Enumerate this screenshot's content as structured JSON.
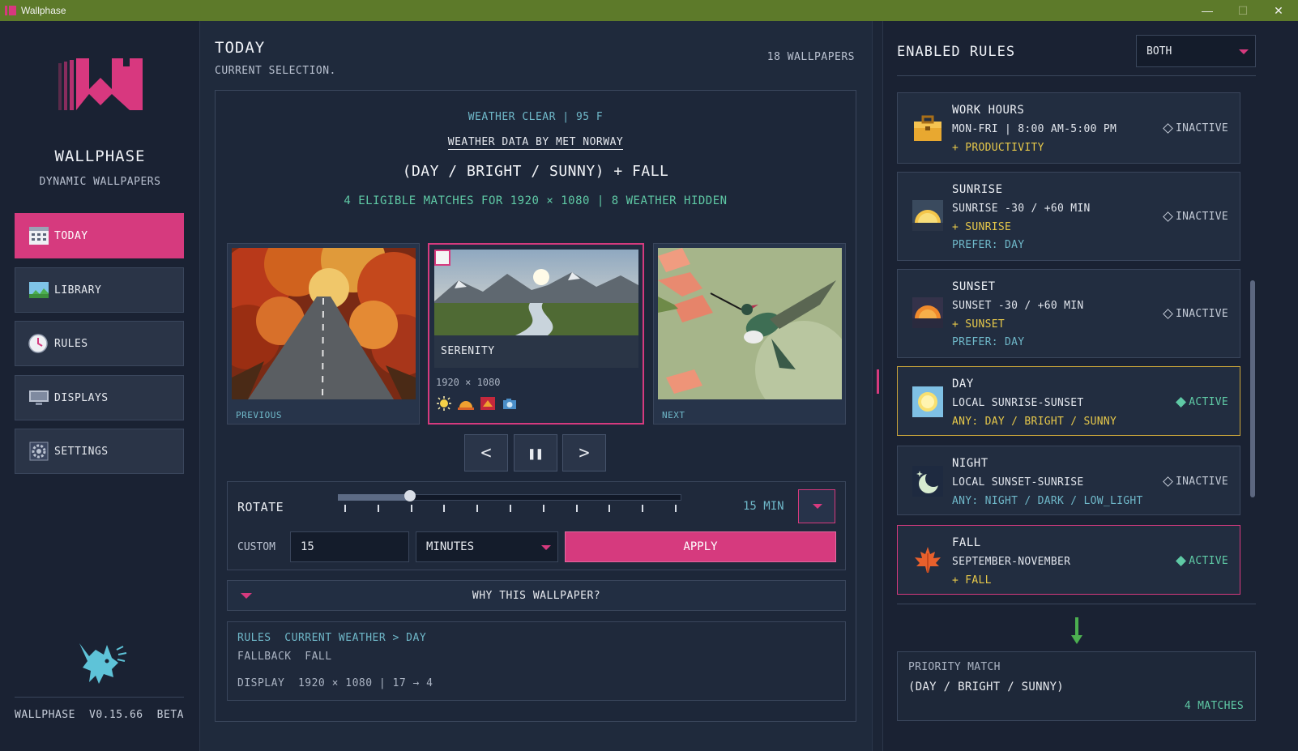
{
  "window": {
    "title": "Wallphase",
    "minimize": "—",
    "maximize": "☐",
    "close": "✕"
  },
  "sidebar": {
    "app_name": "WALLPHASE",
    "app_sub": "DYNAMIC WALLPAPERS",
    "nav": [
      {
        "label": "TODAY",
        "icon": "calendar-icon"
      },
      {
        "label": "LIBRARY",
        "icon": "landscape-icon"
      },
      {
        "label": "RULES",
        "icon": "clock-icon"
      },
      {
        "label": "DISPLAYS",
        "icon": "monitor-icon"
      },
      {
        "label": "SETTINGS",
        "icon": "gear-icon"
      }
    ],
    "footer": {
      "name": "WALLPHASE",
      "version": "V0.15.66",
      "channel": "BETA"
    }
  },
  "main": {
    "title": "TODAY",
    "subtitle": "CURRENT SELECTION.",
    "count": "18 WALLPAPERS",
    "weather_line": "WEATHER  CLEAR  |  95 F",
    "weather_credit": "WEATHER DATA BY MET NORWAY",
    "rule_combo": "(DAY / BRIGHT / SUNNY) + FALL",
    "match_line": "4 ELIGIBLE MATCHES FOR 1920 × 1080  |  8 WEATHER HIDDEN",
    "cards": {
      "prev_caption": "PREVIOUS",
      "next_caption": "NEXT",
      "current": {
        "name": "SERENITY",
        "resolution": "1920 × 1080",
        "tags": [
          "sun-icon",
          "sunset-icon",
          "fall-tag-icon",
          "camera-icon"
        ]
      }
    },
    "controls": {
      "prev": "<",
      "pause": "❚❚",
      "next": ">"
    },
    "rotate": {
      "label": "ROTATE",
      "value_label": "15 MIN",
      "slider_position": 0.21,
      "tick_count": 11,
      "custom_label": "CUSTOM",
      "custom_value": "15",
      "unit": "MINUTES",
      "apply": "APPLY"
    },
    "why": "WHY THIS WALLPAPER?",
    "reasons": {
      "rules_label": "RULES",
      "rules_path": "CURRENT WEATHER  >  DAY",
      "fallback_label": "FALLBACK",
      "fallback_value": "FALL",
      "display_label": "DISPLAY",
      "display_value": "1920 × 1080  |  17 → 4"
    }
  },
  "rules_panel": {
    "title": "ENABLED RULES",
    "filter": "BOTH",
    "rules": [
      {
        "name": "WORK HOURS",
        "line1": "MON-FRI  |  8:00 AM-5:00 PM",
        "line2": "+ PRODUCTIVITY",
        "line3": "",
        "status": "INACTIVE",
        "icon": "briefcase-icon"
      },
      {
        "name": "SUNRISE",
        "line1": "SUNRISE  -30 / +60 MIN",
        "line2": "+ SUNRISE",
        "line3": "PREFER: DAY",
        "status": "INACTIVE",
        "icon": "sunrise-icon"
      },
      {
        "name": "SUNSET",
        "line1": "SUNSET  -30 / +60 MIN",
        "line2": "+ SUNSET",
        "line3": "PREFER: DAY",
        "status": "INACTIVE",
        "icon": "sunset-icon"
      },
      {
        "name": "DAY",
        "line1": "LOCAL SUNRISE-SUNSET",
        "line2": "ANY: DAY / BRIGHT / SUNNY",
        "line3": "",
        "status": "ACTIVE",
        "icon": "sun-icon"
      },
      {
        "name": "NIGHT",
        "line1": "LOCAL SUNSET-SUNRISE",
        "line2": "ANY: NIGHT / DARK / LOW_LIGHT",
        "line3": "",
        "status": "INACTIVE",
        "icon": "moon-icon"
      },
      {
        "name": "FALL",
        "line1": "SEPTEMBER-NOVEMBER",
        "line2": "+ FALL",
        "line3": "",
        "status": "ACTIVE",
        "icon": "maple-leaf-icon"
      }
    ],
    "priority": {
      "label": "PRIORITY MATCH",
      "value": "(DAY / BRIGHT / SUNNY)",
      "count": "4 MATCHES"
    }
  },
  "colors": {
    "accent": "#d63a7e",
    "teal": "#6fb8c9",
    "green": "#5fc9a5",
    "titlebar": "#5d7a2a"
  }
}
